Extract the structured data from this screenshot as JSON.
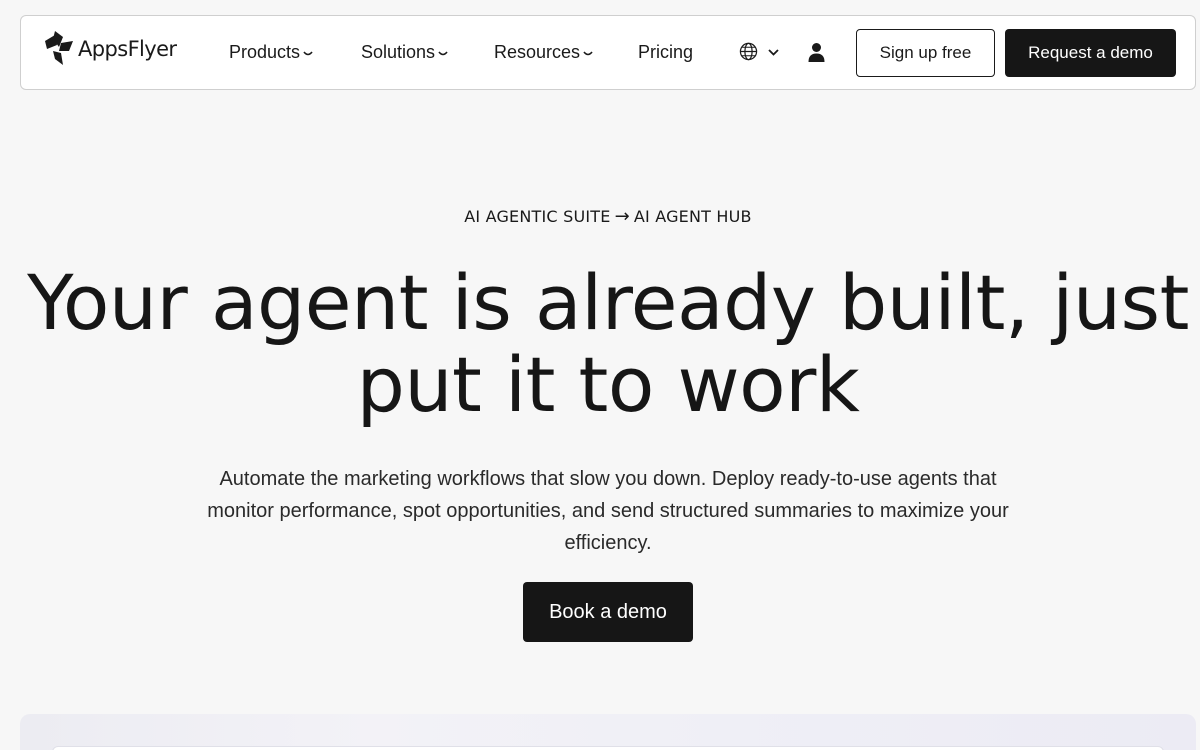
{
  "nav": {
    "brand": "AppsFlyer",
    "items": [
      {
        "label": "Products",
        "has_dropdown": true
      },
      {
        "label": "Solutions",
        "has_dropdown": true
      },
      {
        "label": "Resources",
        "has_dropdown": true
      },
      {
        "label": "Pricing",
        "has_dropdown": false
      }
    ],
    "language_icon": "globe-icon",
    "account_icon": "user-icon",
    "signup_label": "Sign up free",
    "demo_label": "Request a demo"
  },
  "hero": {
    "breadcrumb_parent": "AI AGENTIC SUITE",
    "breadcrumb_separator": "→",
    "breadcrumb_current": "AI AGENT HUB",
    "title_line1": "Your agent is already built, just",
    "title_line2": "put it to work",
    "subtitle": "Automate the marketing workflows that slow you down. Deploy ready-to-use agents that monitor performance, spot opportunities, and send structured summaries to maximize your efficiency.",
    "cta_label": "Book a demo"
  },
  "colors": {
    "background": "#f7f7f7",
    "text": "#1a1a1a",
    "primary_button": "#161616",
    "nav_background": "#ffffff"
  }
}
